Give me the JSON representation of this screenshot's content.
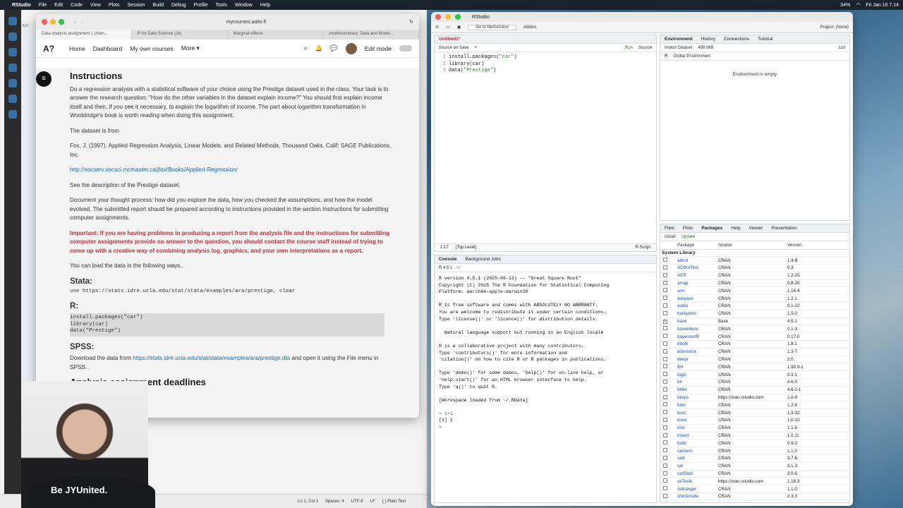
{
  "menubar": {
    "app": "RStudio",
    "items": [
      "File",
      "Edit",
      "Code",
      "View",
      "Plots",
      "Session",
      "Build",
      "Debug",
      "Profile",
      "Tools",
      "Window",
      "Help"
    ],
    "clock": "Fri Jan 16 7.14",
    "battery": "34%"
  },
  "bg_ide": {
    "panel_label": "EXI",
    "status": [
      "Ln 1, Col 1",
      "Spaces: 4",
      "UTF-8",
      "LF",
      "{ } Plain Text"
    ]
  },
  "browser": {
    "url": "mycourses.aalto.fi",
    "tabs": [
      "Data analysis assignment 1 (man...",
      "R for Data Science (2e)",
      "Marginal effects",
      "modelsummary: Data and Model..."
    ],
    "nav": {
      "logo": "A?",
      "home": "Home",
      "dashboard": "Dashboard",
      "courses": "My own courses",
      "more": "More",
      "edit_mode": "Edit mode"
    },
    "content": {
      "heading": "Instructions",
      "p1": "Do a regression analysis with a statistical software of your choice using the Prestige dataset used in the class. Your task is to answer the research question: \"How do the other variables in the dataset explain income?\" You should first explain income itself and then, if you see it necessary, to explain the logarithm of income. The part about logarithm transformation in Wooldridge's book is worth reading when doing this assignment.",
      "p2": "The dataset is from",
      "p3": "Fox, J. (1997). Applied Regression Analysis, Linear Models, and Related Methods. Thousand Oaks, Calif: SAGE Publications, Inc.",
      "link1": "http://socserv.socsci.mcmaster.ca/jfox/Books/Applied-Regression/",
      "p4": "See the description of the Prestige dataset.",
      "p5": "Document your thought process: how did you explore the data, how you checked the assumptions, and how the model evolved. The submitted report should be prepared according to instructions provided in the section Instructions for submitting computer assignments.",
      "warning": "Important: If you are having problems in producing a report from the analysis file and the instructions for submitting computer assignments provide no answer to the question, you should contact the course staff instead of trying to come up with a creative way of combining analysis log, graphics, and your own interpretations as a report.",
      "p6": "You can load the data in the following ways.",
      "stata_h": "Stata:",
      "stata_code": "use https://stats.idre.ucla.edu/stat/stata/examples/ara/prestige, clear",
      "r_h": "R:",
      "r_code": [
        "install.packages(\"car\")",
        "library(car)",
        "data(\"Prestige\")"
      ],
      "spss_h": "SPSS:",
      "spss_pre": "Download the data from ",
      "spss_link": "https://stats.idre.ucla.edu/stat/stata/examples/ara/prestige.dta",
      "spss_post": " and open it using the File menu in SPSS.",
      "deadlines": "Analysis assignment deadlines"
    }
  },
  "rstudio": {
    "title": "RStudio",
    "toolbar": {
      "goto": "Go to file/function",
      "addins": "Addins",
      "project": "Project: (None)"
    },
    "editor": {
      "tab": "Untitled1*",
      "source_on_save": "Source on Save",
      "run": "Run",
      "source": "Source",
      "lines": [
        {
          "n": "1",
          "pre": "install.packages(",
          "str": "\"car\"",
          "post": ")"
        },
        {
          "n": "2",
          "pre": "library(car)",
          "str": "",
          "post": ""
        },
        {
          "n": "3",
          "pre": "data(",
          "str": "\"Prestige\"",
          "post": ")"
        }
      ],
      "status_pos": "1:17",
      "status_level": "(Top Level)",
      "status_type": "R Script"
    },
    "console": {
      "tabs": [
        "Console",
        "Background Jobs"
      ],
      "path": "R 4.5.1 · ~/",
      "text": "R version 4.5.1 (2025-06-13) -- \"Great Square Root\"\nCopyright (C) 2025 The R Foundation for Statistical Computing\nPlatform: aarch64-apple-darwin20\n\nR is free software and comes with ABSOLUTELY NO WARRANTY.\nYou are welcome to redistribute it under certain conditions.\nType 'license()' or 'licence()' for distribution details.\n\n  Natural language support but running in an English locale\n\nR is a collaborative project with many contributors.\nType 'contributors()' for more information and\n'citation()' on how to cite R or R packages in publications.\n\nType 'demo()' for some demos, 'help()' for on-line help, or\n'help.start()' for an HTML browser interface to help.\nType 'q()' to quit R.\n\n[Workspace loaded from ~/.RData]\n",
      "cmd": "> 1+1",
      "result": "[1] 2",
      "prompt": ">"
    },
    "env": {
      "tabs": [
        "Environment",
        "History",
        "Connections",
        "Tutorial"
      ],
      "import": "Import Dataset",
      "mem": "458 MiB",
      "list": "List",
      "lang": "R",
      "scope": "Global Environment",
      "empty": "Environment is empty"
    },
    "files": {
      "tabs": [
        "Files",
        "Plots",
        "Packages",
        "Help",
        "Viewer",
        "Presentation"
      ],
      "install": "Install",
      "update": "Update",
      "headers": [
        "Package",
        "Source",
        "Version"
      ],
      "library_label": "System Library",
      "packages": [
        [
          "abind",
          "CRAN",
          "1.4-8"
        ],
        [
          "ADGofTest",
          "CRAN",
          "0.3"
        ],
        [
          "AER",
          "CRAN",
          "1.2-15"
        ],
        [
          "amap",
          "CRAN",
          "0.8-20"
        ],
        [
          "arm",
          "CRAN",
          "1.14-4"
        ],
        [
          "askpass",
          "CRAN",
          "1.2.1"
        ],
        [
          "audio",
          "CRAN",
          "0.1-12"
        ],
        [
          "backports",
          "CRAN",
          "1.5.0"
        ],
        [
          "base",
          "Base",
          "4.5.1"
        ],
        [
          "base64enc",
          "CRAN",
          "0.1-3"
        ],
        [
          "bayestestR",
          "CRAN",
          "0.17.0"
        ],
        [
          "bbotk",
          "CRAN",
          "1.8.1"
        ],
        [
          "bdsmatrix",
          "CRAN",
          "1.3-7"
        ],
        [
          "beepr",
          "CRAN",
          "2.0"
        ],
        [
          "BH",
          "CRAN",
          "1.90.0-1"
        ],
        [
          "bigD",
          "CRAN",
          "0.3.1"
        ],
        [
          "bit",
          "CRAN",
          "4.6.0"
        ],
        [
          "bit64",
          "CRAN",
          "4.6.0-1"
        ],
        [
          "bitops",
          "https://cran.rstudio.com",
          "1.0-9"
        ],
        [
          "blob",
          "CRAN",
          "1.2.4"
        ],
        [
          "boot",
          "CRAN",
          "1.3-32"
        ],
        [
          "brew",
          "CRAN",
          "1.0-10"
        ],
        [
          "brio",
          "CRAN",
          "1.1.5"
        ],
        [
          "broom",
          "CRAN",
          "1.0.11"
        ],
        [
          "bslib",
          "CRAN",
          "0.9.0"
        ],
        [
          "cachem",
          "CRAN",
          "1.1.0"
        ],
        [
          "callr",
          "CRAN",
          "3.7.6"
        ],
        [
          "car",
          "CRAN",
          "3.1-3"
        ],
        [
          "carData",
          "CRAN",
          "3.0-5"
        ],
        [
          "caTools",
          "https://cran.rstudio.com",
          "1.18.3"
        ],
        [
          "cellranger",
          "CRAN",
          "1.1.0"
        ],
        [
          "checkmate",
          "CRAN",
          "2.3.3"
        ]
      ]
    }
  },
  "webcam": {
    "shirt_text": "Be JYUnited."
  }
}
